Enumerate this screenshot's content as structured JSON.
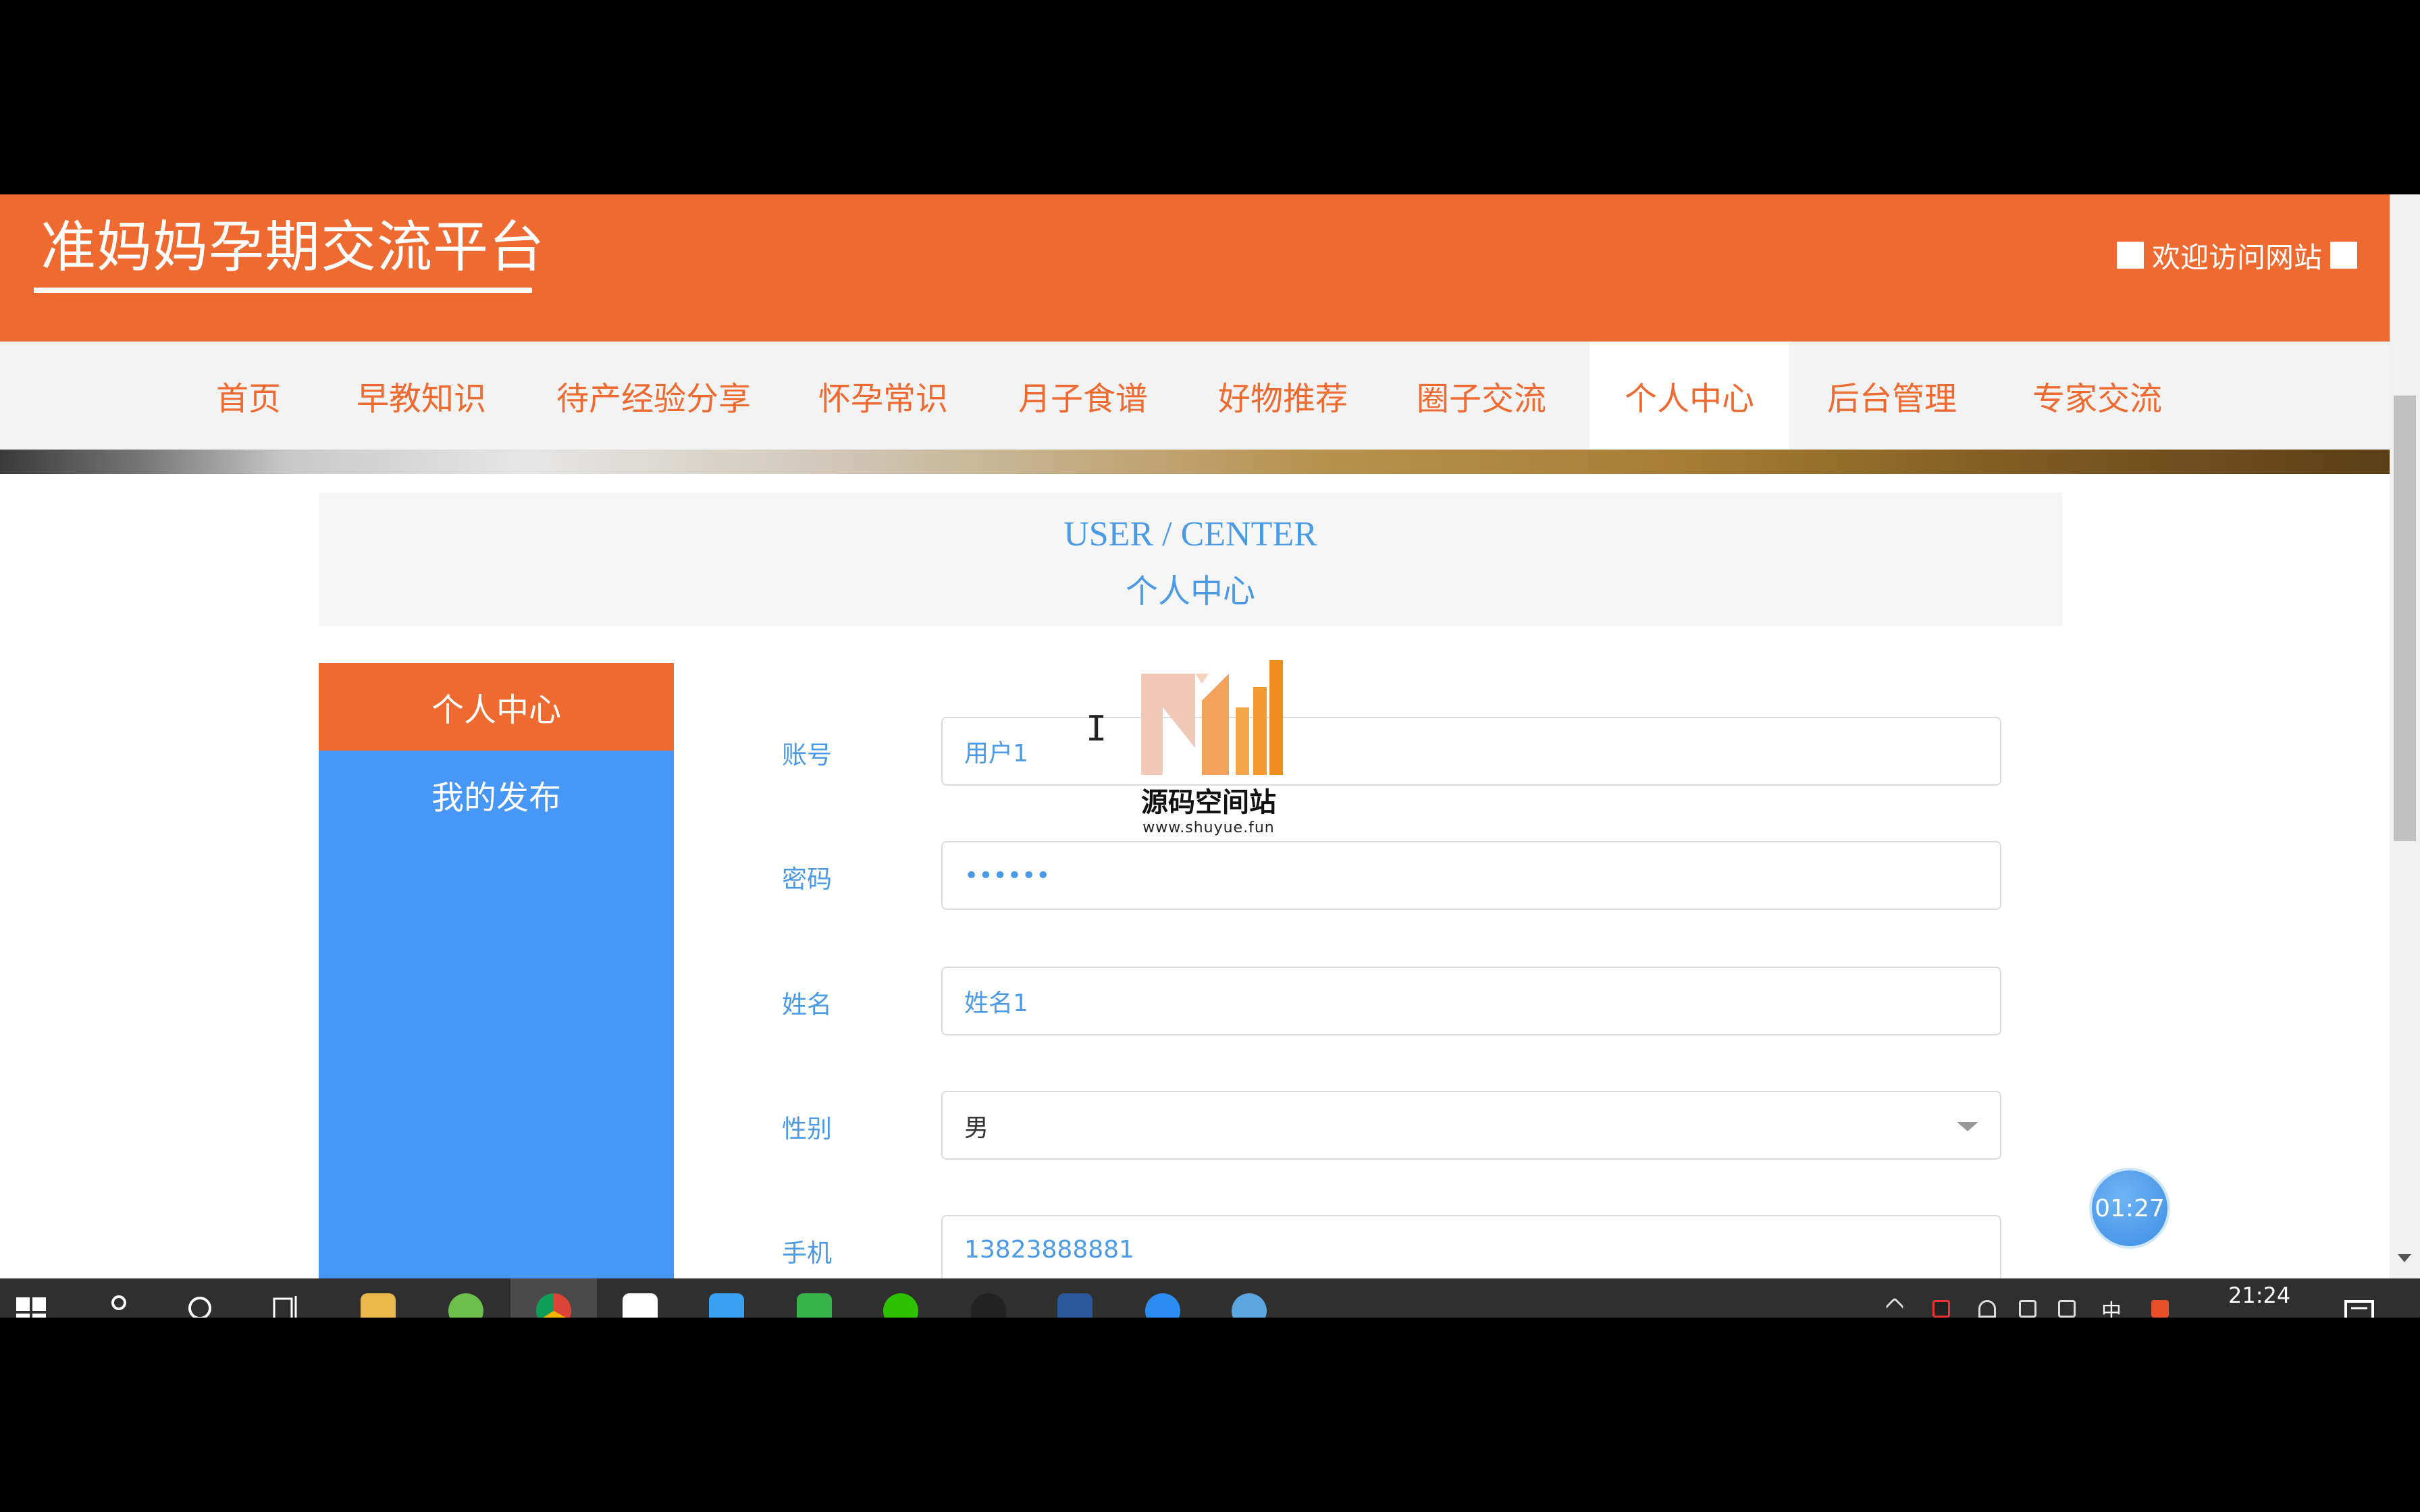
{
  "site": {
    "title": "准妈妈孕期交流平台",
    "welcome": "欢迎访问网站"
  },
  "colors": {
    "header": "#ef6a30",
    "nav_text": "#ef6a30",
    "sidebar_active": "#ef6a30",
    "sidebar": "#4697f8",
    "heading_blue": "#4a9ae6",
    "input_text": "#4a9ae6",
    "taskbar": "#2f2f2f"
  },
  "nav": {
    "items": [
      {
        "label": "首页"
      },
      {
        "label": "早教知识"
      },
      {
        "label": "待产经验分享"
      },
      {
        "label": "怀孕常识"
      },
      {
        "label": "月子食谱"
      },
      {
        "label": "好物推荐"
      },
      {
        "label": "圈子交流"
      },
      {
        "label": "个人中心",
        "active": true
      },
      {
        "label": "后台管理"
      },
      {
        "label": "专家交流"
      }
    ]
  },
  "section": {
    "en": "USER / CENTER",
    "cn": "个人中心"
  },
  "sidebar": {
    "items": [
      {
        "label": "个人中心",
        "active": true
      },
      {
        "label": "我的发布"
      }
    ]
  },
  "form": {
    "account": {
      "label": "账号",
      "value": "用户1"
    },
    "password": {
      "label": "密码",
      "value": "••••••"
    },
    "name": {
      "label": "姓名",
      "value": "姓名1"
    },
    "gender": {
      "label": "性别",
      "value": "男"
    },
    "phone": {
      "label": "手机",
      "value": "13823888881"
    }
  },
  "watermark": {
    "name": "源码空间站",
    "url": "www.shuyue.fun"
  },
  "recorder": {
    "timer": "01:27"
  },
  "taskbar": {
    "clock": "21:24",
    "ime": "中"
  }
}
